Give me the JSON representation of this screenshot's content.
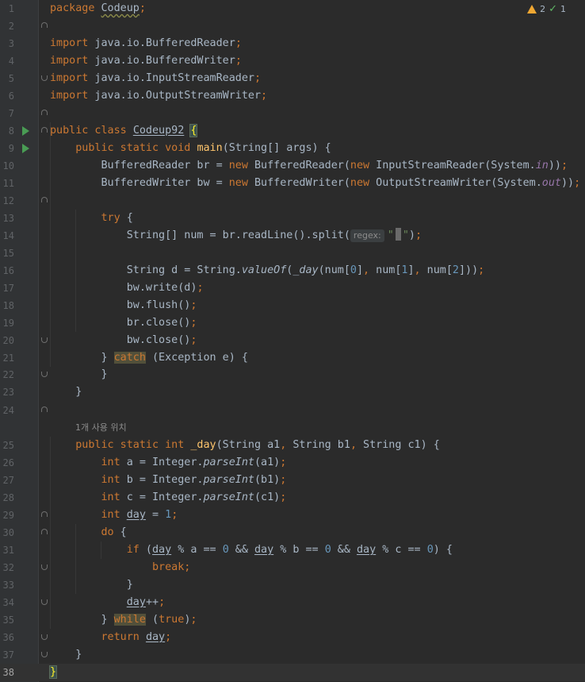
{
  "inspections": {
    "warnings": "2",
    "weak_warnings": "1",
    "warning_icon": "warning-triangle",
    "check_icon": "double-check"
  },
  "usages_hint": "1개 사용 위치",
  "param_hint": "regex:",
  "lines": [
    [
      [
        "k",
        "package"
      ],
      [
        "t",
        " "
      ],
      [
        "sq",
        "Codeup"
      ],
      [
        "k",
        ";"
      ]
    ],
    [],
    [
      [
        "k",
        "import"
      ],
      [
        "t",
        " java.io.BufferedReader"
      ],
      [
        "k",
        ";"
      ]
    ],
    [
      [
        "k",
        "import"
      ],
      [
        "t",
        " java.io.BufferedWriter"
      ],
      [
        "k",
        ";"
      ]
    ],
    [
      [
        "k",
        "import"
      ],
      [
        "t",
        " java.io.InputStreamReader"
      ],
      [
        "k",
        ";"
      ]
    ],
    [
      [
        "k",
        "import"
      ],
      [
        "t",
        " java.io.OutputStreamWriter"
      ],
      [
        "k",
        ";"
      ]
    ],
    [],
    [
      [
        "k",
        "public class"
      ],
      [
        "t",
        " "
      ],
      [
        "ul",
        "Codeup92"
      ],
      [
        "t",
        " "
      ],
      [
        "brace",
        "{"
      ]
    ],
    [
      [
        "t",
        "    "
      ],
      [
        "k",
        "public static void"
      ],
      [
        "t",
        " "
      ],
      [
        "fn",
        "main"
      ],
      [
        "t",
        "(String[] args) {"
      ]
    ],
    [
      [
        "t",
        "        BufferedReader br = "
      ],
      [
        "k",
        "new"
      ],
      [
        "t",
        " BufferedReader("
      ],
      [
        "k",
        "new"
      ],
      [
        "t",
        " InputStreamReader(System."
      ],
      [
        "st",
        "in"
      ],
      [
        "t",
        "))"
      ],
      [
        "k",
        ";"
      ]
    ],
    [
      [
        "t",
        "        BufferedWriter bw = "
      ],
      [
        "k",
        "new"
      ],
      [
        "t",
        " BufferedWriter("
      ],
      [
        "k",
        "new"
      ],
      [
        "t",
        " OutputStreamWriter(System."
      ],
      [
        "st",
        "out"
      ],
      [
        "t",
        "))"
      ],
      [
        "k",
        ";"
      ]
    ],
    [],
    [
      [
        "t",
        "        "
      ],
      [
        "k",
        "try"
      ],
      [
        "t",
        " {"
      ]
    ],
    [
      [
        "t",
        "            String[] num = br.readLine().split("
      ],
      [
        "hint",
        ""
      ],
      [
        "s",
        "\""
      ],
      [
        "caret",
        ""
      ],
      [
        "s",
        "\""
      ],
      [
        "t",
        ")"
      ],
      [
        "k",
        ";"
      ]
    ],
    [],
    [
      [
        "t",
        "            String d = String."
      ],
      [
        "sf",
        "valueOf"
      ],
      [
        "t",
        "("
      ],
      [
        "sf",
        "_day"
      ],
      [
        "t",
        "(num["
      ],
      [
        "nu",
        "0"
      ],
      [
        "t",
        "]"
      ],
      [
        "k",
        ","
      ],
      [
        "t",
        " num["
      ],
      [
        "nu",
        "1"
      ],
      [
        "t",
        "]"
      ],
      [
        "k",
        ","
      ],
      [
        "t",
        " num["
      ],
      [
        "nu",
        "2"
      ],
      [
        "t",
        "]))"
      ],
      [
        "k",
        ";"
      ]
    ],
    [
      [
        "t",
        "            bw.write(d)"
      ],
      [
        "k",
        ";"
      ]
    ],
    [
      [
        "t",
        "            bw.flush()"
      ],
      [
        "k",
        ";"
      ]
    ],
    [
      [
        "t",
        "            br.close()"
      ],
      [
        "k",
        ";"
      ]
    ],
    [
      [
        "t",
        "            bw.close()"
      ],
      [
        "k",
        ";"
      ]
    ],
    [
      [
        "t",
        "        } "
      ],
      [
        "hlk",
        "catch"
      ],
      [
        "t",
        " (Exception e) {"
      ]
    ],
    [
      [
        "t",
        "        }"
      ]
    ],
    [
      [
        "t",
        "    }"
      ]
    ],
    [],
    [
      [
        "t",
        "    "
      ],
      [
        "k",
        "public static int"
      ],
      [
        "t",
        " "
      ],
      [
        "fn",
        "_day"
      ],
      [
        "t",
        "(String a1"
      ],
      [
        "k",
        ","
      ],
      [
        "t",
        " String b1"
      ],
      [
        "k",
        ","
      ],
      [
        "t",
        " String c1) {"
      ]
    ],
    [
      [
        "t",
        "        "
      ],
      [
        "k",
        "int"
      ],
      [
        "t",
        " a = Integer."
      ],
      [
        "sf",
        "parseInt"
      ],
      [
        "t",
        "(a1)"
      ],
      [
        "k",
        ";"
      ]
    ],
    [
      [
        "t",
        "        "
      ],
      [
        "k",
        "int"
      ],
      [
        "t",
        " b = Integer."
      ],
      [
        "sf",
        "parseInt"
      ],
      [
        "t",
        "(b1)"
      ],
      [
        "k",
        ";"
      ]
    ],
    [
      [
        "t",
        "        "
      ],
      [
        "k",
        "int"
      ],
      [
        "t",
        " c = Integer."
      ],
      [
        "sf",
        "parseInt"
      ],
      [
        "t",
        "(c1)"
      ],
      [
        "k",
        ";"
      ]
    ],
    [
      [
        "t",
        "        "
      ],
      [
        "k",
        "int"
      ],
      [
        "t",
        " "
      ],
      [
        "ul",
        "day"
      ],
      [
        "t",
        " = "
      ],
      [
        "nu",
        "1"
      ],
      [
        "k",
        ";"
      ]
    ],
    [
      [
        "t",
        "        "
      ],
      [
        "k",
        "do"
      ],
      [
        "t",
        " {"
      ]
    ],
    [
      [
        "t",
        "            "
      ],
      [
        "k",
        "if"
      ],
      [
        "t",
        " ("
      ],
      [
        "ul",
        "day"
      ],
      [
        "t",
        " % a == "
      ],
      [
        "nu",
        "0"
      ],
      [
        "t",
        " && "
      ],
      [
        "ul",
        "day"
      ],
      [
        "t",
        " % b == "
      ],
      [
        "nu",
        "0"
      ],
      [
        "t",
        " && "
      ],
      [
        "ul",
        "day"
      ],
      [
        "t",
        " % c == "
      ],
      [
        "nu",
        "0"
      ],
      [
        "t",
        ") {"
      ]
    ],
    [
      [
        "t",
        "                "
      ],
      [
        "k",
        "break;"
      ]
    ],
    [
      [
        "t",
        "            }"
      ]
    ],
    [
      [
        "t",
        "            "
      ],
      [
        "ul",
        "day"
      ],
      [
        "t",
        "++"
      ],
      [
        "k",
        ";"
      ]
    ],
    [
      [
        "t",
        "        } "
      ],
      [
        "hlk",
        "while"
      ],
      [
        "t",
        " ("
      ],
      [
        "k",
        "true"
      ],
      [
        "t",
        ")"
      ],
      [
        "k",
        ";"
      ]
    ],
    [
      [
        "t",
        "        "
      ],
      [
        "k",
        "return"
      ],
      [
        "t",
        " "
      ],
      [
        "ul",
        "day"
      ],
      [
        "k",
        ";"
      ]
    ],
    [
      [
        "t",
        "    }"
      ]
    ],
    [
      [
        "brace",
        "}"
      ]
    ]
  ]
}
